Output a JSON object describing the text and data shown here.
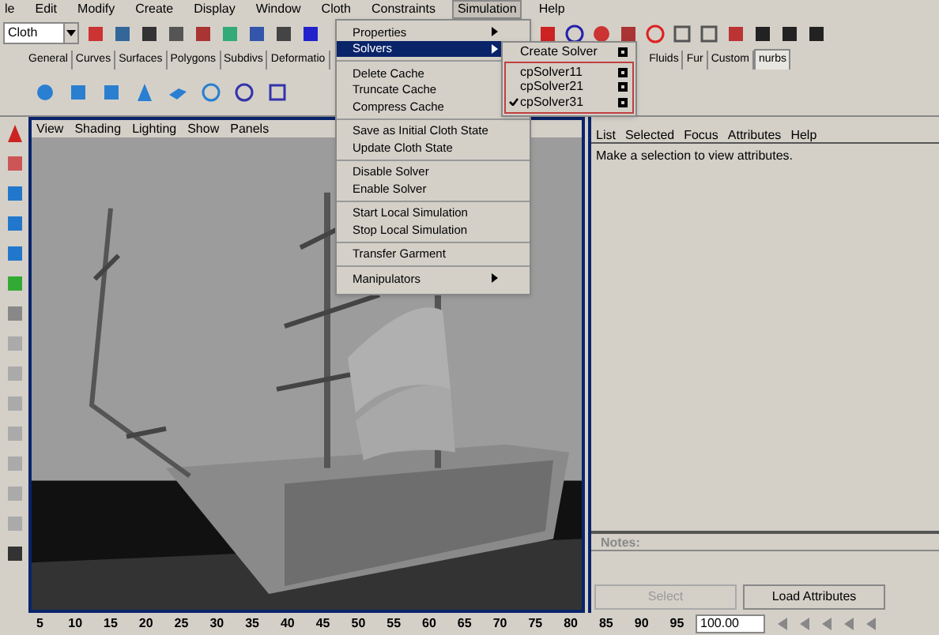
{
  "menubar": [
    {
      "label": "le",
      "selected": false
    },
    {
      "label": "Edit",
      "selected": false
    },
    {
      "label": "Modify",
      "selected": false
    },
    {
      "label": "Create",
      "selected": false
    },
    {
      "label": "Display",
      "selected": false
    },
    {
      "label": "Window",
      "selected": false
    },
    {
      "label": "Cloth",
      "selected": false
    },
    {
      "label": "Constraints",
      "selected": false
    },
    {
      "label": "Simulation",
      "selected": true
    },
    {
      "label": "Help",
      "selected": false
    }
  ],
  "toolbar": {
    "mode": "Cloth"
  },
  "shelf_tabs": [
    {
      "label": "General",
      "selected": false
    },
    {
      "label": "Curves",
      "selected": false
    },
    {
      "label": "Surfaces",
      "selected": false
    },
    {
      "label": "Polygons",
      "selected": false
    },
    {
      "label": "Subdivs",
      "selected": false
    },
    {
      "label": "Deformatio",
      "selected": false
    },
    {
      "label": "Fluids",
      "selected": false
    },
    {
      "label": "Fur",
      "selected": false
    },
    {
      "label": "Custom",
      "selected": false
    },
    {
      "label": "nurbs",
      "selected": true
    }
  ],
  "simulation_menu": {
    "sections": [
      [
        {
          "label": "Properties",
          "submenu": true,
          "selected": false
        },
        {
          "label": "Solvers",
          "submenu": true,
          "selected": true
        }
      ],
      [
        {
          "label": "Delete Cache",
          "submenu": false,
          "selected": false
        },
        {
          "label": "Truncate Cache",
          "submenu": false,
          "selected": false
        },
        {
          "label": "Compress Cache",
          "submenu": false,
          "selected": false
        }
      ],
      [
        {
          "label": "Save as Initial Cloth State",
          "submenu": false,
          "selected": false
        },
        {
          "label": "Update Cloth State",
          "submenu": false,
          "selected": false
        }
      ],
      [
        {
          "label": "Disable Solver",
          "submenu": false,
          "selected": false
        },
        {
          "label": "Enable Solver",
          "submenu": false,
          "selected": false
        }
      ],
      [
        {
          "label": "Start Local Simulation",
          "submenu": false,
          "selected": false
        },
        {
          "label": "Stop Local Simulation",
          "submenu": false,
          "selected": false
        }
      ],
      [
        {
          "label": "Transfer Garment",
          "submenu": false,
          "selected": false
        }
      ],
      [
        {
          "label": "Manipulators",
          "submenu": true,
          "selected": false
        }
      ]
    ]
  },
  "solvers_submenu": {
    "create": "Create Solver",
    "solvers": [
      {
        "label": "cpSolver11",
        "checked": false
      },
      {
        "label": "cpSolver21",
        "checked": false
      },
      {
        "label": "cpSolver31",
        "checked": true
      }
    ]
  },
  "viewport": {
    "menu": [
      "View",
      "Shading",
      "Lighting",
      "Show",
      "Panels"
    ]
  },
  "attribute_editor": {
    "menu": [
      "List",
      "Selected",
      "Focus",
      "Attributes",
      "Help"
    ],
    "message": "Make a selection to view attributes.",
    "notes_label": "Notes:",
    "buttons": [
      {
        "label": "Select",
        "disabled": true
      },
      {
        "label": "Load Attributes",
        "disabled": false
      }
    ]
  },
  "timeline": {
    "ticks": [
      "5",
      "10",
      "15",
      "20",
      "25",
      "30",
      "35",
      "40",
      "45",
      "50",
      "55",
      "60",
      "65",
      "70",
      "75",
      "80",
      "85",
      "90",
      "95"
    ],
    "end_time": "100.00"
  }
}
